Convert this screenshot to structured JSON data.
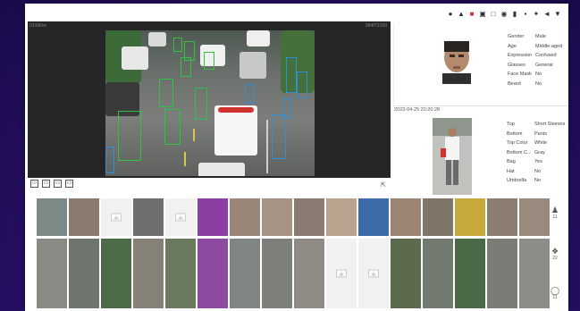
{
  "video": {
    "channel": "01/06/xx",
    "resolution": "3840*2160"
  },
  "toolbar_icons": [
    "person-icon",
    "pin-icon",
    "record-icon",
    "snapshot-icon",
    "square-icon",
    "circle-icon",
    "mic-icon",
    "camera-icon",
    "fullscreen-icon",
    "audio-icon",
    "download-icon"
  ],
  "face": {
    "attributes": [
      {
        "label": "Gender",
        "value": "Male"
      },
      {
        "label": "Age",
        "value": "Middle-aged"
      },
      {
        "label": "Expression",
        "value": "Confused"
      },
      {
        "label": "Glasses",
        "value": "General"
      },
      {
        "label": "Face Mask",
        "value": "No"
      },
      {
        "label": "Beard",
        "value": "No"
      }
    ]
  },
  "timestamp": "2023-04-25 20:20:28",
  "body": {
    "attributes": [
      {
        "label": "Top",
        "value": "Short Sleeves"
      },
      {
        "label": "Bottom",
        "value": "Pants"
      },
      {
        "label": "Top Color",
        "value": "White"
      },
      {
        "label": "Bottom C...",
        "value": "Gray"
      },
      {
        "label": "Bag",
        "value": "Yes"
      },
      {
        "label": "Hat",
        "value": "No"
      },
      {
        "label": "Umbrella",
        "value": "No"
      }
    ]
  },
  "side_counts": {
    "face": "11",
    "people": "22",
    "bike": "11"
  },
  "colors": {
    "accent": "#d0332f",
    "detect_green": "#31c241",
    "detect_blue": "#2f8fd8",
    "background": "#2c1172"
  }
}
